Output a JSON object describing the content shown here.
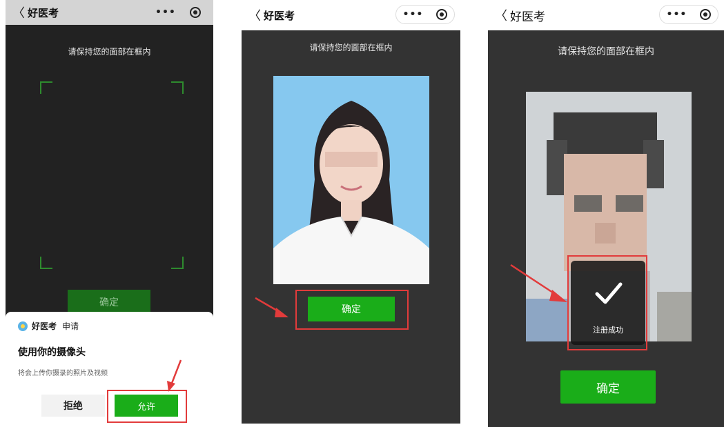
{
  "screen1": {
    "nav": {
      "back": "〈",
      "title": "好医考",
      "more": "•••"
    },
    "hint": "请保持您的面部在框内",
    "confirm": "确定",
    "sheet": {
      "app_name": "好医考",
      "apply": "申请",
      "title": "使用你的摄像头",
      "desc": "将会上传你摄录的照片及视频",
      "deny": "拒绝",
      "allow": "允许"
    }
  },
  "screen2": {
    "nav": {
      "back": "〈",
      "title": "好医考",
      "more": "•••"
    },
    "hint": "请保持您的面部在框内",
    "confirm": "确定"
  },
  "screen3": {
    "nav": {
      "back": "〈",
      "title": "好医考",
      "more": "•••"
    },
    "hint": "请保持您的面部在框内",
    "toast": "注册成功",
    "confirm": "确定"
  },
  "colors": {
    "accent": "#1aad19",
    "highlight": "#e23b3b",
    "dark_bg": "#333333",
    "photo_bg": "#86c8ef"
  }
}
